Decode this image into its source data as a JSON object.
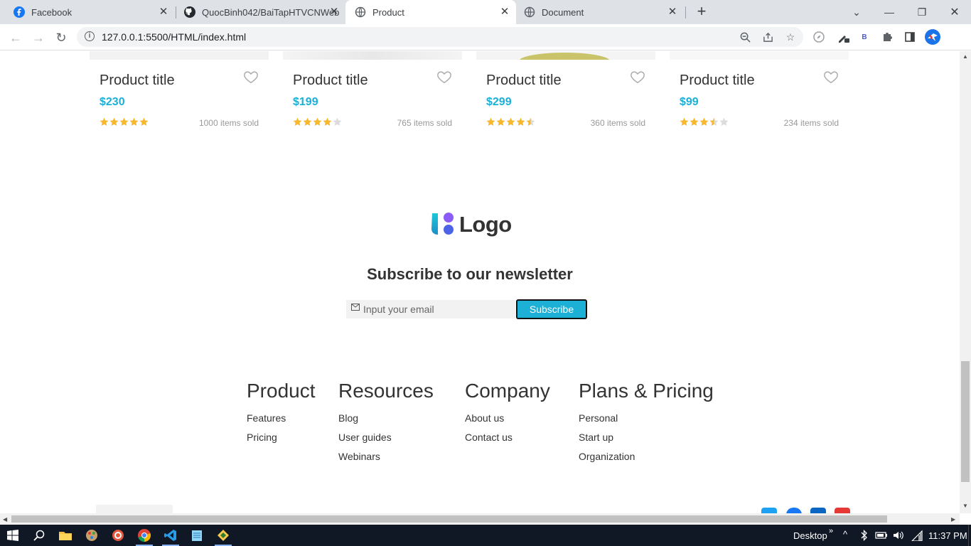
{
  "browser": {
    "tabs": [
      {
        "title": "Facebook",
        "favicon": "facebook-icon",
        "active": false
      },
      {
        "title": "QuocBinh042/BaiTapHTVCNWeb",
        "favicon": "github-icon",
        "active": false
      },
      {
        "title": "Product",
        "favicon": "globe-icon",
        "active": true
      },
      {
        "title": "Document",
        "favicon": "globe-icon",
        "active": false
      }
    ],
    "url": "127.0.0.1:5500/HTML/index.html",
    "extension_badge": "B"
  },
  "products": [
    {
      "title": "Product title",
      "price": "$230",
      "rating": 5,
      "sold": "1000 items sold"
    },
    {
      "title": "Product title",
      "price": "$199",
      "rating": 4,
      "sold": "765 items sold"
    },
    {
      "title": "Product title",
      "price": "$299",
      "rating": 4.5,
      "sold": "360 items sold"
    },
    {
      "title": "Product title",
      "price": "$99",
      "rating": 3.5,
      "sold": "234 items sold"
    }
  ],
  "logo": {
    "text": "Logo"
  },
  "newsletter": {
    "title": "Subscribe to our newsletter",
    "placeholder": "Input your email",
    "button": "Subscribe"
  },
  "footer": {
    "columns": [
      {
        "heading": "Product",
        "links": [
          "Features",
          "Pricing"
        ]
      },
      {
        "heading": "Resources",
        "links": [
          "Blog",
          "User guides",
          "Webinars"
        ]
      },
      {
        "heading": "Company",
        "links": [
          "About us",
          "Contact us"
        ]
      },
      {
        "heading": "Plans & Pricing",
        "links": [
          "Personal",
          "Start up",
          "Organization"
        ]
      }
    ]
  },
  "taskbar": {
    "desktop_label": "Desktop",
    "time": "11:37 PM"
  },
  "colors": {
    "accent": "#1cb0d6",
    "star": "#f5b82e",
    "star_empty": "#dcdcdc"
  }
}
